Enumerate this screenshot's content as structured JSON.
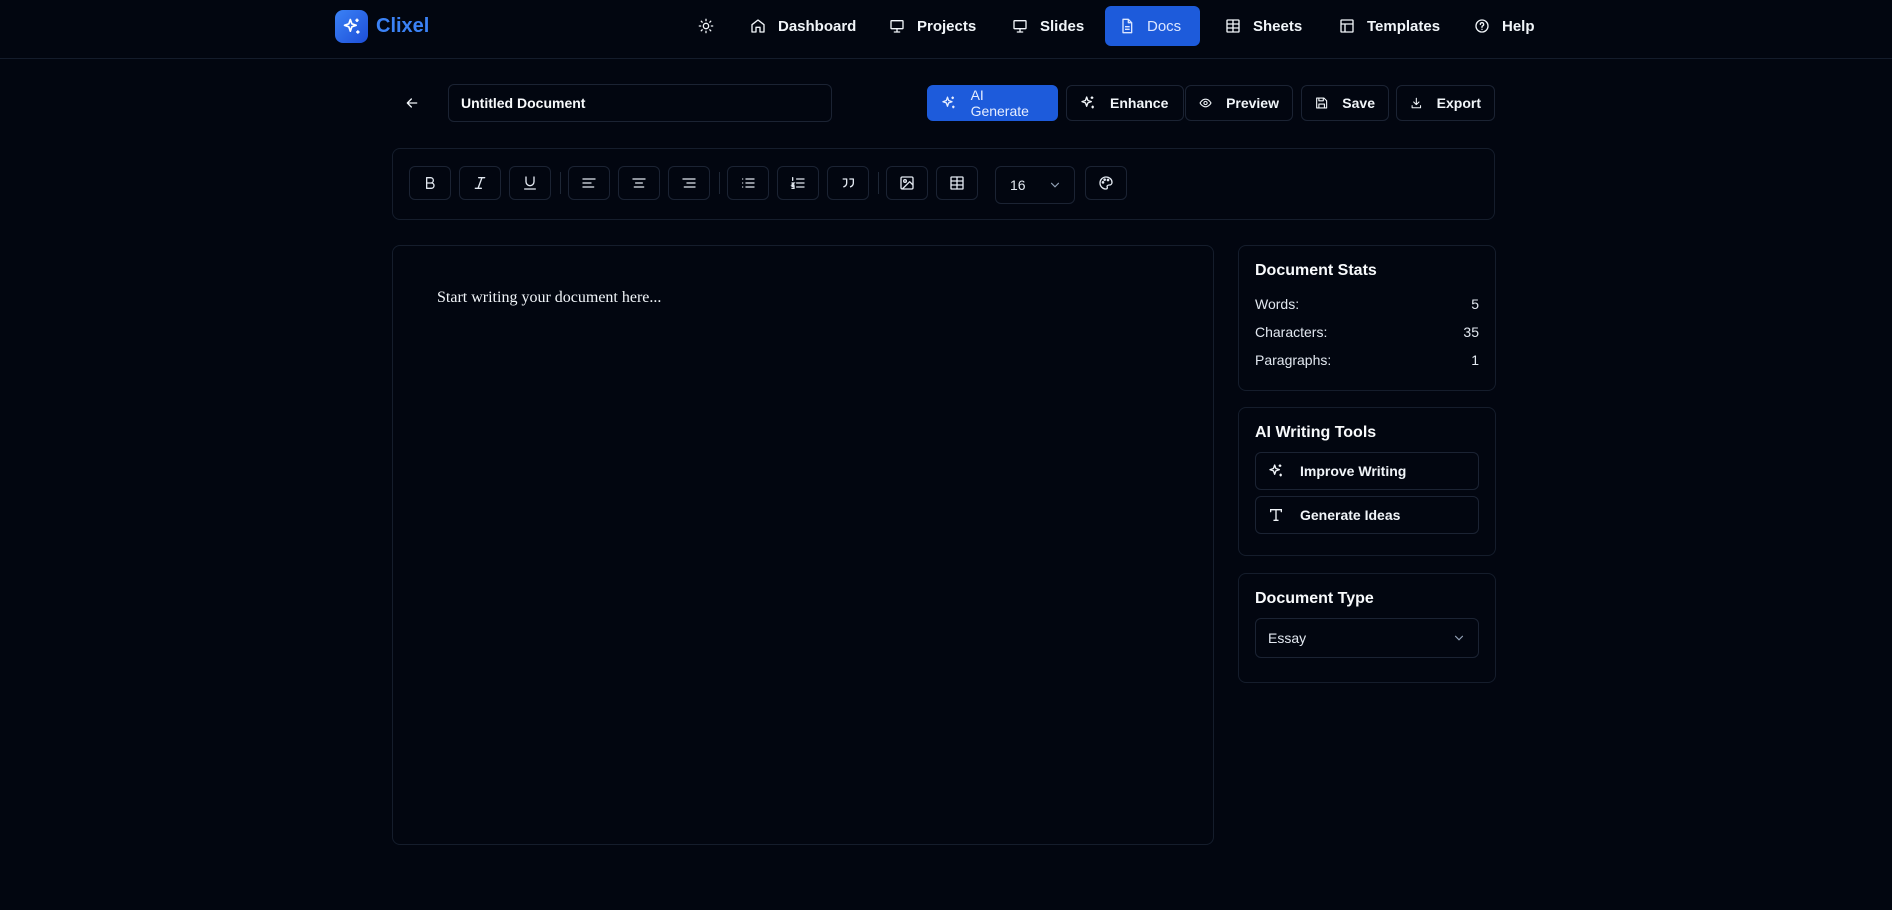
{
  "brand": {
    "name": "Clixel",
    "icon": "sparkles-icon",
    "accent": "#3b82f6"
  },
  "nav": {
    "theme_icon": "sun-icon",
    "items": [
      {
        "label": "Dashboard",
        "icon": "home-icon"
      },
      {
        "label": "Projects",
        "icon": "presentation-icon"
      },
      {
        "label": "Slides",
        "icon": "presentation-icon"
      },
      {
        "label": "Docs",
        "icon": "document-icon",
        "active": true
      },
      {
        "label": "Sheets",
        "icon": "table-icon"
      },
      {
        "label": "Templates",
        "icon": "layout-icon"
      },
      {
        "label": "Help",
        "icon": "help-circle-icon"
      }
    ]
  },
  "header": {
    "back_icon": "arrow-left-icon",
    "title_value": "Untitled Document",
    "actions": [
      {
        "label": "AI Generate",
        "icon": "sparkles-icon",
        "primary": true
      },
      {
        "label": "Enhance",
        "icon": "sparkles-icon"
      },
      {
        "label": "Preview",
        "icon": "eye-icon"
      },
      {
        "label": "Save",
        "icon": "save-icon"
      },
      {
        "label": "Export",
        "icon": "download-icon"
      }
    ]
  },
  "toolbar": {
    "buttons": [
      "bold-icon",
      "italic-icon",
      "underline-icon",
      "align-left-icon",
      "align-center-icon",
      "align-right-icon",
      "bullet-list-icon",
      "numbered-list-icon",
      "quote-icon",
      "image-icon",
      "table-icon",
      "palette-icon"
    ],
    "font_size": "16"
  },
  "editor": {
    "content": "Start writing your document here..."
  },
  "stats": {
    "title": "Document Stats",
    "rows": [
      {
        "label": "Words:",
        "value": "5"
      },
      {
        "label": "Characters:",
        "value": "35"
      },
      {
        "label": "Paragraphs:",
        "value": "1"
      }
    ]
  },
  "ai_tools": {
    "title": "AI Writing Tools",
    "items": [
      {
        "label": "Improve Writing",
        "icon": "sparkles-icon"
      },
      {
        "label": "Generate Ideas",
        "icon": "type-icon"
      }
    ]
  },
  "doc_type": {
    "title": "Document Type",
    "selected": "Essay"
  },
  "colors": {
    "background": "#020610",
    "primary": "#1d5bdb",
    "border": "#1b2333"
  }
}
